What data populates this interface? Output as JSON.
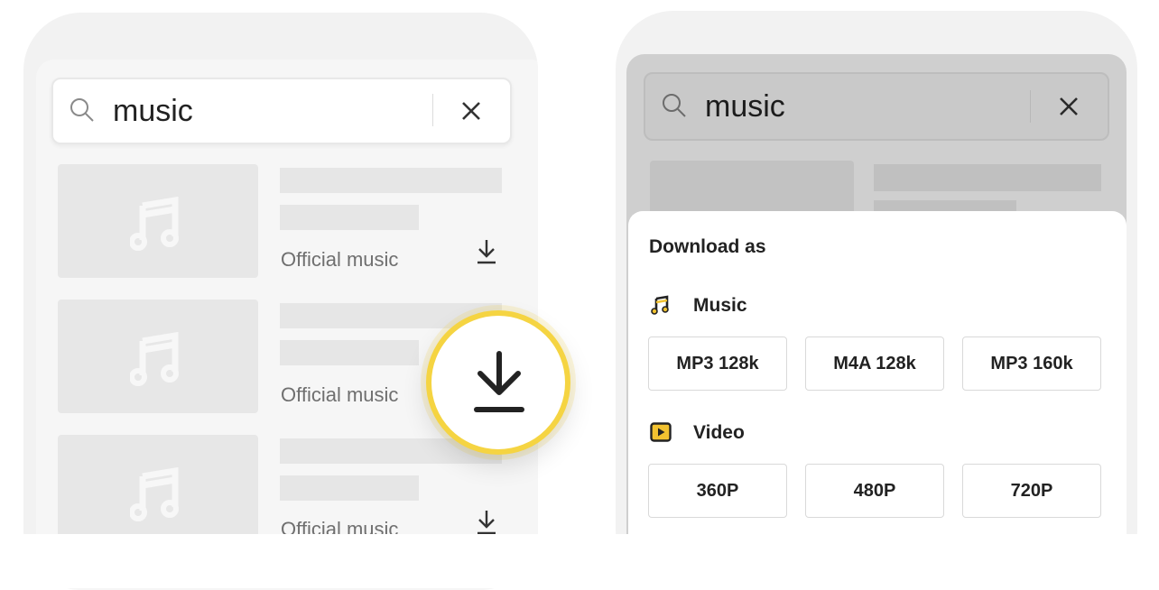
{
  "left_screen": {
    "search": {
      "query": "music"
    },
    "results": [
      {
        "subtitle": "Official music"
      },
      {
        "subtitle": "Official music"
      },
      {
        "subtitle": "Official music"
      }
    ]
  },
  "right_screen": {
    "search": {
      "query": "music"
    },
    "sheet": {
      "title": "Download as",
      "music": {
        "label": "Music",
        "options": [
          "MP3 128k",
          "M4A 128k",
          "MP3 160k"
        ]
      },
      "video": {
        "label": "Video",
        "options": [
          "360P",
          "480P",
          "720P"
        ]
      }
    }
  },
  "colors": {
    "accent": "#f5d442",
    "icon_yellow": "#f2c230",
    "placeholder": "#e6e6e6",
    "overlay": "#cfcfcf"
  }
}
